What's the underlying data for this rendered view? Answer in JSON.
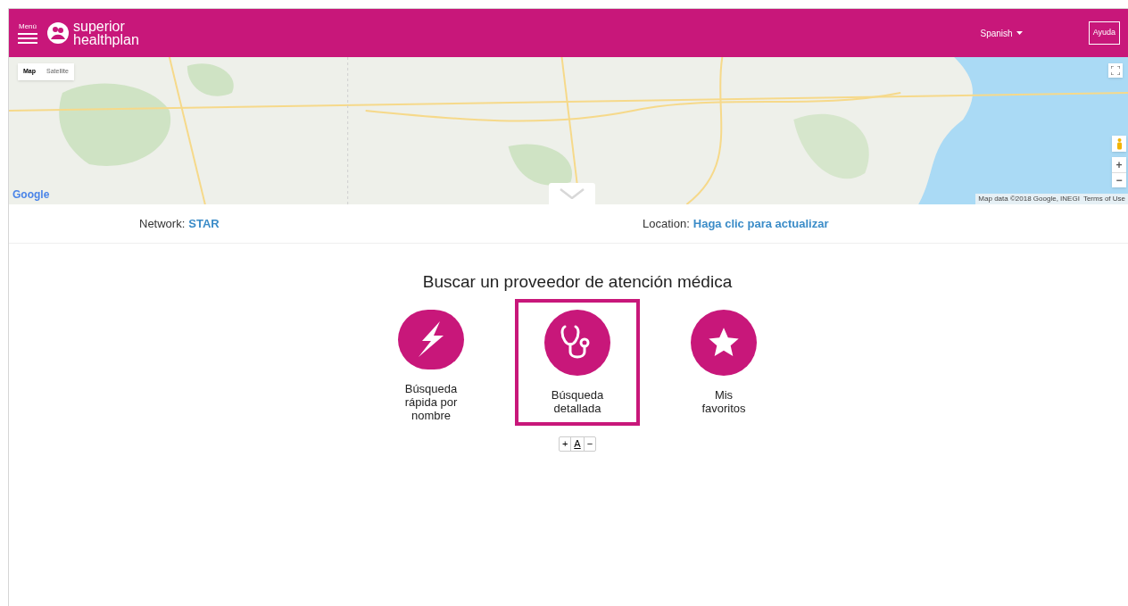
{
  "header": {
    "menu_label": "Menú",
    "logo_line_1": "superior",
    "logo_line_2": "healthplan",
    "language": "Spanish",
    "help_button": "Ayuda"
  },
  "map": {
    "kind": "picture",
    "map_types": [
      {
        "label": "Map",
        "selected": true
      },
      {
        "label": "Satellite",
        "selected": false
      }
    ],
    "zoom_in": "+",
    "zoom_out": "−",
    "google": "Google",
    "attribution": "Map data ©2018 Google, INEGI",
    "terms": "Terms of Use"
  },
  "info": {
    "network_label": "Network:",
    "network_value": "STAR",
    "location_label": "Location:",
    "location_link": "Haga clic para actualizar"
  },
  "search": {
    "title": "Buscar un proveedor de atención médica",
    "options": [
      {
        "kind": "bolt",
        "label": "Búsqueda rápida por nombre",
        "selected": false
      },
      {
        "kind": "stethoscope",
        "label": "Búsqueda detallada",
        "selected": true
      },
      {
        "kind": "star",
        "label": "Mis favoritos",
        "selected": false
      }
    ]
  },
  "font_controls": [
    "+",
    "A",
    "−"
  ]
}
